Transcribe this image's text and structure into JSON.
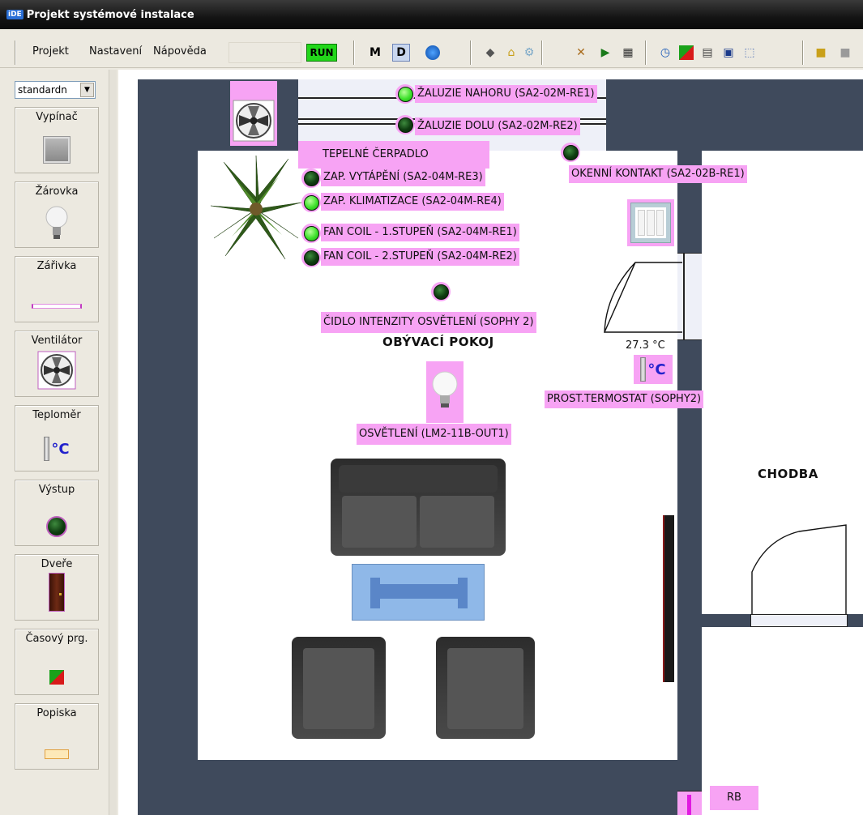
{
  "window": {
    "title": "Projekt systémové instalace",
    "logo_text": "iDE"
  },
  "menu": {
    "items": [
      "Projekt",
      "Nastavení",
      "Nápověda"
    ]
  },
  "toolbar": {
    "run_label": "RUN",
    "m_label": "M",
    "d_label": "D"
  },
  "palette": {
    "select_value": "standardn",
    "items": [
      {
        "label": "Vypínač",
        "icon": "switch-icon"
      },
      {
        "label": "Žárovka",
        "icon": "bulb-icon"
      },
      {
        "label": "Zářivka",
        "icon": "tube-light-icon"
      },
      {
        "label": "Ventilátor",
        "icon": "fan-icon"
      },
      {
        "label": "Teploměr",
        "icon": "thermometer-icon"
      },
      {
        "label": "Výstup",
        "icon": "output-led-icon"
      },
      {
        "label": "Dveře",
        "icon": "door-icon"
      },
      {
        "label": "Časový prg.",
        "icon": "time-program-icon"
      },
      {
        "label": "Popiska",
        "icon": "caption-icon"
      }
    ]
  },
  "plan": {
    "rooms": {
      "living": "OBÝVACÍ POKOJ",
      "hall": "CHODBA"
    },
    "blinds_up": "ŽALUZIE NAHORU (SA2-02M-RE1)",
    "blinds_down": "ŽALUZIE DOLU (SA2-02M-RE2)",
    "heat_pump": "TEPELNÉ ČERPADLO",
    "window_contact": "OKENNÍ KONTAKT (SA2-02B-RE1)",
    "heating": "ZAP. VYTÁPĚNÍ (SA2-04M-RE3)",
    "cooling": "ZAP. KLIMATIZACE (SA2-04M-RE4)",
    "fancoil1": "FAN COIL - 1.STUPEŇ (SA2-04M-RE1)",
    "fancoil2": "FAN COIL - 2.STUPEŇ (SA2-04M-RE2)",
    "light_sensor": "ČIDLO INTENZITY OSVĚTLENÍ (SOPHY 2)",
    "temperature": "27.3 °C",
    "thermostat_unit": "°C",
    "thermostat": "PROST.TERMOSTAT (SOPHY2)",
    "lighting": "OSVĚTLENÍ (LM2-11B-OUT1)",
    "rb_label": "RB"
  },
  "colors": {
    "wall": "#3f4a5c",
    "tag": "#f7a3f4",
    "led_on": "#3ee12c",
    "led_off": "#0e3d10",
    "run": "#22d61a"
  }
}
